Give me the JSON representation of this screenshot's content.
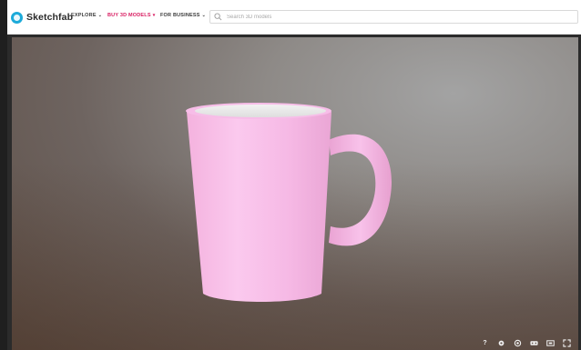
{
  "header": {
    "logo_text": "Sketchfab",
    "nav": [
      {
        "label": "EXPLORE"
      },
      {
        "label": "BUY 3D MODELS"
      },
      {
        "label": "FOR BUSINESS"
      }
    ],
    "search_placeholder": "Search 3D models"
  },
  "viewer": {
    "model": "pink coffee mug",
    "controls": [
      {
        "icon": "help-icon",
        "glyph": "?"
      },
      {
        "icon": "settings-icon"
      },
      {
        "icon": "inspector-icon"
      },
      {
        "icon": "vr-icon"
      },
      {
        "icon": "screen-icon"
      },
      {
        "icon": "fullscreen-icon"
      }
    ]
  },
  "colors": {
    "accent": "#d81b60",
    "brand": "#1caad9",
    "mug_pink": "#f5b8e4"
  }
}
